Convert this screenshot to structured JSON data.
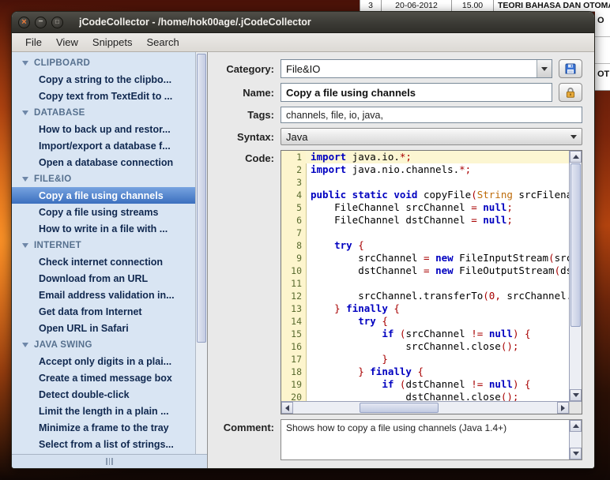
{
  "desktop": {
    "bg_table_row": [
      "3",
      "20-06-2012",
      "15.00",
      "TEORI BAHASA DAN OTOMA"
    ],
    "right_fragments": [
      "O",
      "OT"
    ]
  },
  "window": {
    "title": "jCodeCollector - /home/hok00age/.jCodeCollector"
  },
  "menubar": {
    "items": [
      "File",
      "View",
      "Snippets",
      "Search"
    ]
  },
  "sidebar": {
    "selected": "Copy a file using channels",
    "sections": [
      {
        "label": "CLIPBOARD",
        "items": [
          "Copy a string to the clipbo...",
          "Copy text from TextEdit to ..."
        ]
      },
      {
        "label": "DATABASE",
        "items": [
          "How to back up and restor...",
          "Import/export a database f...",
          "Open a database connection"
        ]
      },
      {
        "label": "FILE&IO",
        "items": [
          "Copy a file using channels",
          "Copy a file using streams",
          "How to write in a file with ..."
        ]
      },
      {
        "label": "INTERNET",
        "items": [
          "Check internet connection",
          "Download from an URL",
          "Email address validation in...",
          "Get data from Internet",
          "Open URL in Safari"
        ]
      },
      {
        "label": "JAVA SWING",
        "items": [
          "Accept only digits in a plai...",
          "Create a timed message box",
          "Detect double-click",
          "Limit the length in a plain ...",
          "Minimize a frame to the tray",
          "Select from a list of strings...",
          "Set the native look&feel"
        ]
      }
    ]
  },
  "form": {
    "category_label": "Category:",
    "category_value": "File&IO",
    "name_label": "Name:",
    "name_value": "Copy a file using channels",
    "tags_label": "Tags:",
    "tags_value": "channels, file, io, java,",
    "syntax_label": "Syntax:",
    "syntax_value": "Java",
    "code_label": "Code:",
    "comment_label": "Comment:",
    "comment_value": "Shows how to copy a file using channels (Java 1.4+)"
  },
  "code": {
    "lines": [
      [
        [
          "kw",
          "import"
        ],
        [
          "pl",
          " java.io."
        ],
        [
          "op",
          "*;"
        ]
      ],
      [
        [
          "kw",
          "import"
        ],
        [
          "pl",
          " java.nio.channels."
        ],
        [
          "op",
          "*;"
        ]
      ],
      [],
      [
        [
          "kw",
          "public static void"
        ],
        [
          "pl",
          " copyFile"
        ],
        [
          "op",
          "("
        ],
        [
          "ty",
          "String"
        ],
        [
          "pl",
          " srcFilename"
        ],
        [
          "op",
          ","
        ]
      ],
      [
        [
          "pl",
          "    FileChannel srcChannel "
        ],
        [
          "op",
          "="
        ],
        [
          "pl",
          " "
        ],
        [
          "kw",
          "null"
        ],
        [
          "op",
          ";"
        ]
      ],
      [
        [
          "pl",
          "    FileChannel dstChannel "
        ],
        [
          "op",
          "="
        ],
        [
          "pl",
          " "
        ],
        [
          "kw",
          "null"
        ],
        [
          "op",
          ";"
        ]
      ],
      [],
      [
        [
          "pl",
          "    "
        ],
        [
          "kw",
          "try"
        ],
        [
          "pl",
          " "
        ],
        [
          "op",
          "{"
        ]
      ],
      [
        [
          "pl",
          "        srcChannel "
        ],
        [
          "op",
          "="
        ],
        [
          "pl",
          " "
        ],
        [
          "kw",
          "new"
        ],
        [
          "pl",
          " FileInputStream"
        ],
        [
          "op",
          "("
        ],
        [
          "pl",
          "srcFilena"
        ]
      ],
      [
        [
          "pl",
          "        dstChannel "
        ],
        [
          "op",
          "="
        ],
        [
          "pl",
          " "
        ],
        [
          "kw",
          "new"
        ],
        [
          "pl",
          " FileOutputStream"
        ],
        [
          "op",
          "("
        ],
        [
          "pl",
          "dstFilen"
        ]
      ],
      [],
      [
        [
          "pl",
          "        srcChannel.transferTo"
        ],
        [
          "op",
          "("
        ],
        [
          "num",
          "0"
        ],
        [
          "op",
          ","
        ],
        [
          "pl",
          " srcChannel.size"
        ],
        [
          "op",
          "()"
        ]
      ],
      [
        [
          "pl",
          "    "
        ],
        [
          "op",
          "}"
        ],
        [
          "pl",
          " "
        ],
        [
          "kw",
          "finally"
        ],
        [
          "pl",
          " "
        ],
        [
          "op",
          "{"
        ]
      ],
      [
        [
          "pl",
          "        "
        ],
        [
          "kw",
          "try"
        ],
        [
          "pl",
          " "
        ],
        [
          "op",
          "{"
        ]
      ],
      [
        [
          "pl",
          "            "
        ],
        [
          "kw",
          "if"
        ],
        [
          "pl",
          " "
        ],
        [
          "op",
          "("
        ],
        [
          "pl",
          "srcChannel "
        ],
        [
          "op",
          "!="
        ],
        [
          "pl",
          " "
        ],
        [
          "kw",
          "null"
        ],
        [
          "op",
          ")"
        ],
        [
          "pl",
          " "
        ],
        [
          "op",
          "{"
        ]
      ],
      [
        [
          "pl",
          "                srcChannel.close"
        ],
        [
          "op",
          "();"
        ]
      ],
      [
        [
          "pl",
          "            "
        ],
        [
          "op",
          "}"
        ]
      ],
      [
        [
          "pl",
          "        "
        ],
        [
          "op",
          "}"
        ],
        [
          "pl",
          " "
        ],
        [
          "kw",
          "finally"
        ],
        [
          "pl",
          " "
        ],
        [
          "op",
          "{"
        ]
      ],
      [
        [
          "pl",
          "            "
        ],
        [
          "kw",
          "if"
        ],
        [
          "pl",
          " "
        ],
        [
          "op",
          "("
        ],
        [
          "pl",
          "dstChannel "
        ],
        [
          "op",
          "!="
        ],
        [
          "pl",
          " "
        ],
        [
          "kw",
          "null"
        ],
        [
          "op",
          ")"
        ],
        [
          "pl",
          " "
        ],
        [
          "op",
          "{"
        ]
      ],
      [
        [
          "pl",
          "                dstChannel.close"
        ],
        [
          "op",
          "();"
        ]
      ]
    ]
  },
  "colors": {
    "selection": "#3b6fbe",
    "selection_light": "#77a3e0",
    "keyword": "#0000c0",
    "operator": "#a80000",
    "type": "#bd6b09",
    "accent_orange": "#ef7b39"
  }
}
